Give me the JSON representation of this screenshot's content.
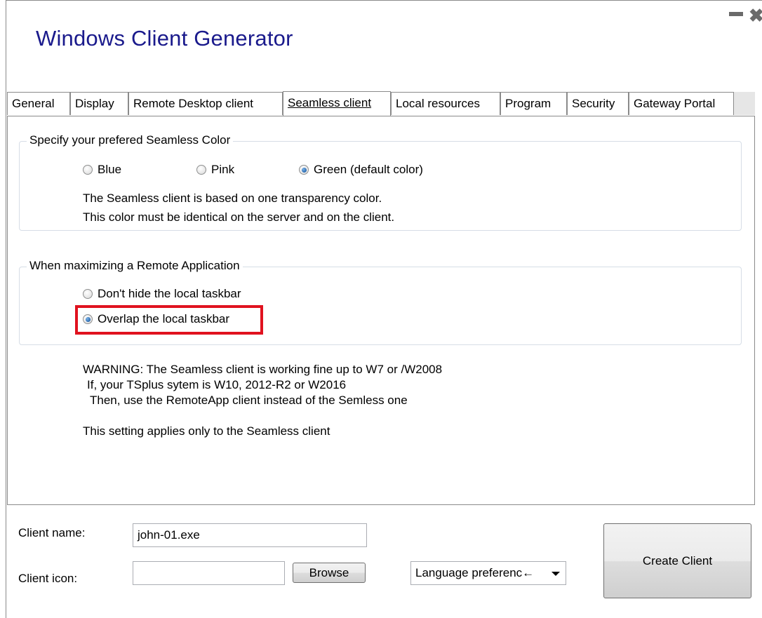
{
  "window": {
    "title": "Windows Client Generator",
    "minimize_icon": "minimize-icon",
    "close_icon": "close-icon"
  },
  "tabs": [
    {
      "label": "General"
    },
    {
      "label": "Display"
    },
    {
      "label": "Remote Desktop client"
    },
    {
      "label": "Seamless client",
      "active": true
    },
    {
      "label": "Local resources"
    },
    {
      "label": "Program"
    },
    {
      "label": "Security"
    },
    {
      "label": "Gateway Portal"
    }
  ],
  "seamless_color": {
    "legend": "Specify your prefered Seamless Color",
    "options": [
      {
        "label": "Blue",
        "checked": false
      },
      {
        "label": "Pink",
        "checked": false
      },
      {
        "label": "Green (default color)",
        "checked": true
      }
    ],
    "info_line1": "The Seamless client is based on one transparency color.",
    "info_line2": "This color must be identical on the server and on the client."
  },
  "maximize": {
    "legend": "When maximizing a Remote Application",
    "options": [
      {
        "label": "Don't hide the local taskbar",
        "checked": false
      },
      {
        "label": "Overlap the local taskbar",
        "checked": true
      }
    ],
    "highlight_color": "#e0121f"
  },
  "warning": {
    "line1": "WARNING: The Seamless client is working fine up to W7 or /W2008",
    "line2": "If, your TSplus sytem is W10, 2012-R2 or W2016",
    "line3": "Then, use the RemoteApp client instead of the Semless one",
    "note": "This setting applies only to the Seamless client"
  },
  "footer": {
    "client_name_label": "Client name:",
    "client_name_value": "john-01.exe",
    "client_icon_label": "Client icon:",
    "client_icon_value": "",
    "browse_label": "Browse",
    "language_label": "Language preferenc←",
    "create_label": "Create Client"
  }
}
